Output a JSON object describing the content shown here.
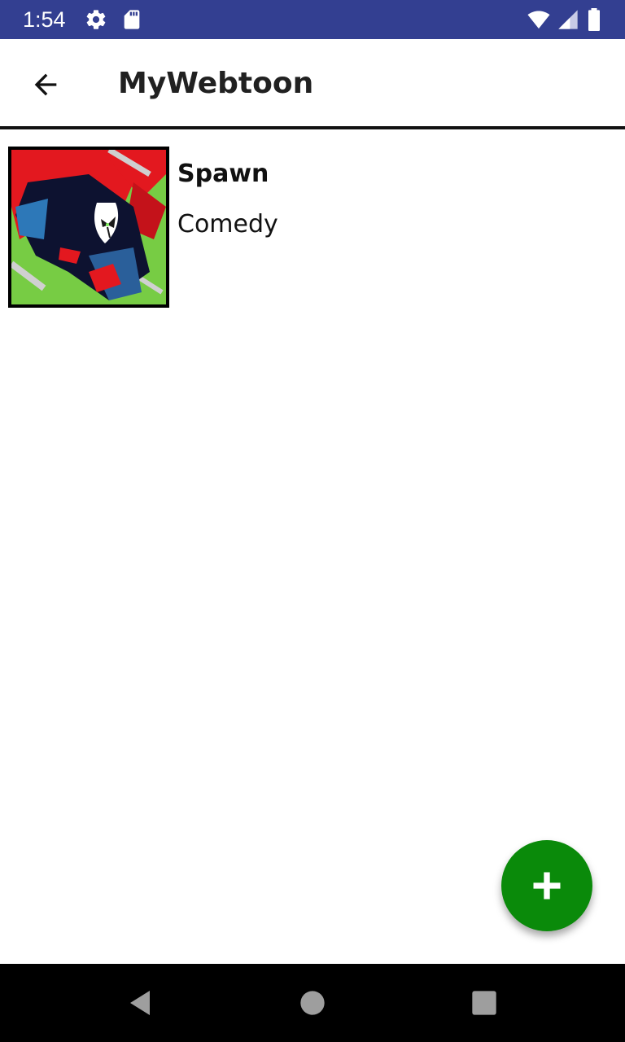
{
  "status_bar": {
    "time": "1:54",
    "icons": [
      "settings-icon",
      "sd-card-icon",
      "wifi-icon",
      "signal-icon",
      "battery-icon"
    ],
    "background": "#333f91"
  },
  "app_bar": {
    "title": "MyWebtoon",
    "back_icon": "arrow-back-icon"
  },
  "list": {
    "items": [
      {
        "title": "Spawn",
        "genre": "Comedy",
        "thumbnail": "comic-cover-image"
      }
    ]
  },
  "fab": {
    "icon": "plus-icon",
    "color": "#0a8a0a"
  },
  "nav_bar": {
    "buttons": [
      "back-triangle-icon",
      "home-circle-icon",
      "recents-square-icon"
    ]
  }
}
